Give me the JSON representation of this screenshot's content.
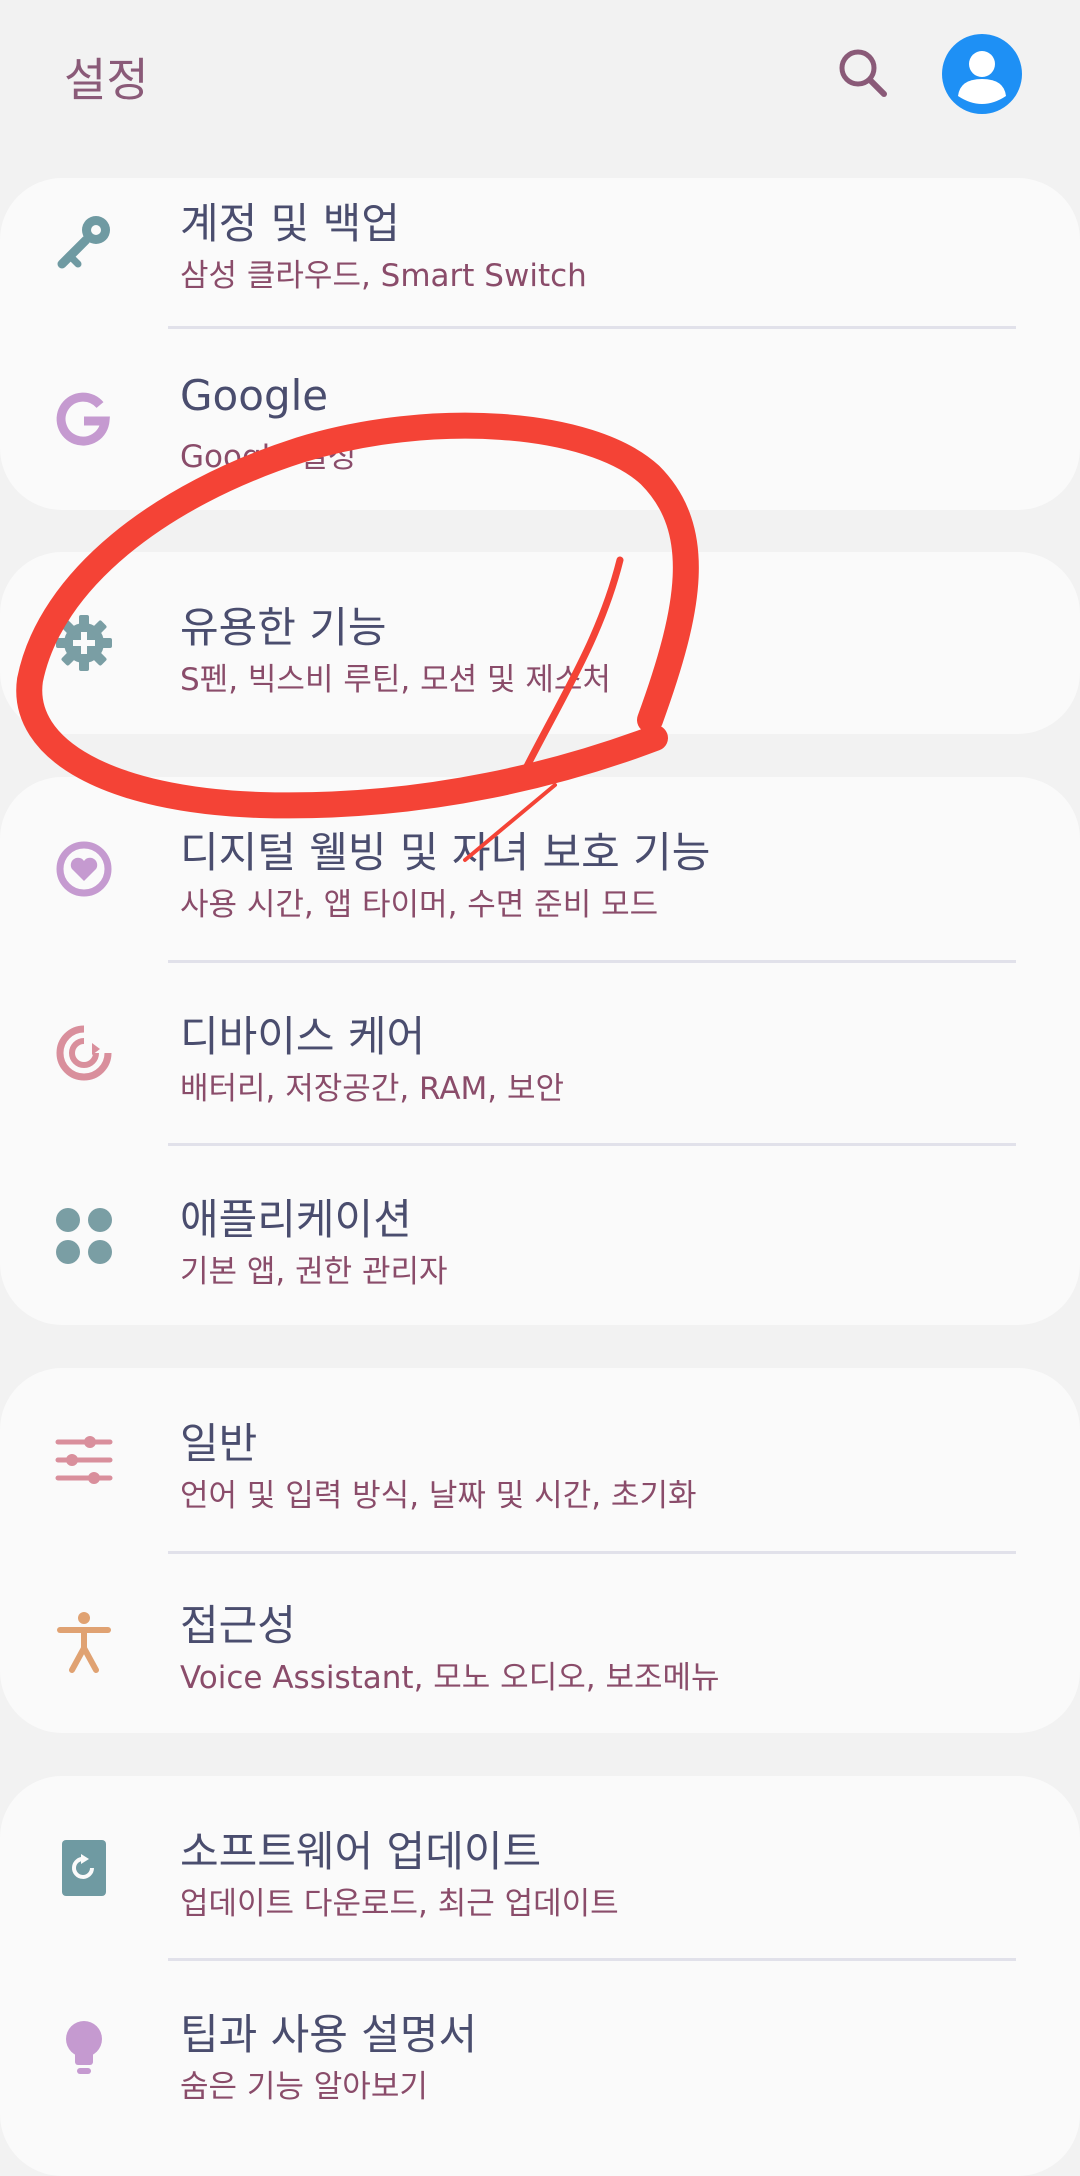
{
  "header": {
    "title": "설정",
    "search_icon": "search-icon",
    "profile_icon": "account-icon",
    "accent_color": "#1e90f5"
  },
  "groups": [
    {
      "items": [
        {
          "title": "계정 및 백업",
          "subtitle": "삼성 클라우드, Smart Switch",
          "icon": "key-icon",
          "icon_color": "#6f9aa2"
        },
        {
          "title": "Google",
          "subtitle": "Google 설정",
          "icon": "google-icon",
          "icon_color": "#c59ad0"
        }
      ]
    },
    {
      "items": [
        {
          "title": "유용한 기능",
          "subtitle": "S펜, 빅스비 루틴, 모션 및 제스처",
          "icon": "gear-plus-icon",
          "icon_color": "#7a9ea4"
        }
      ]
    },
    {
      "items": [
        {
          "title": "디지털 웰빙 및 자녀 보호 기능",
          "subtitle": "사용 시간, 앱 타이머, 수면 준비 모드",
          "icon": "wellbeing-icon",
          "icon_color": "#c59ad0"
        },
        {
          "title": "디바이스 케어",
          "subtitle": "배터리, 저장공간, RAM, 보안",
          "icon": "device-care-icon",
          "icon_color": "#d98f9c"
        },
        {
          "title": "애플리케이션",
          "subtitle": "기본 앱, 권한 관리자",
          "icon": "apps-icon",
          "icon_color": "#7a9ea4"
        }
      ]
    },
    {
      "items": [
        {
          "title": "일반",
          "subtitle": "언어 및 입력 방식, 날짜 및 시간, 초기화",
          "icon": "sliders-icon",
          "icon_color": "#d98f9c"
        },
        {
          "title": "접근성",
          "subtitle": "Voice Assistant, 모노 오디오, 보조메뉴",
          "icon": "accessibility-icon",
          "icon_color": "#e0a272"
        }
      ]
    },
    {
      "items": [
        {
          "title": "소프트웨어 업데이트",
          "subtitle": "업데이트 다운로드, 최근 업데이트",
          "icon": "software-update-icon",
          "icon_color": "#6f9aa2"
        },
        {
          "title": "팁과 사용 설명서",
          "subtitle": "숨은 기능 알아보기",
          "icon": "lightbulb-icon",
          "icon_color": "#c59ad0"
        }
      ]
    }
  ],
  "annotation": {
    "shape": "hand-drawn circle",
    "color": "#f44336"
  }
}
